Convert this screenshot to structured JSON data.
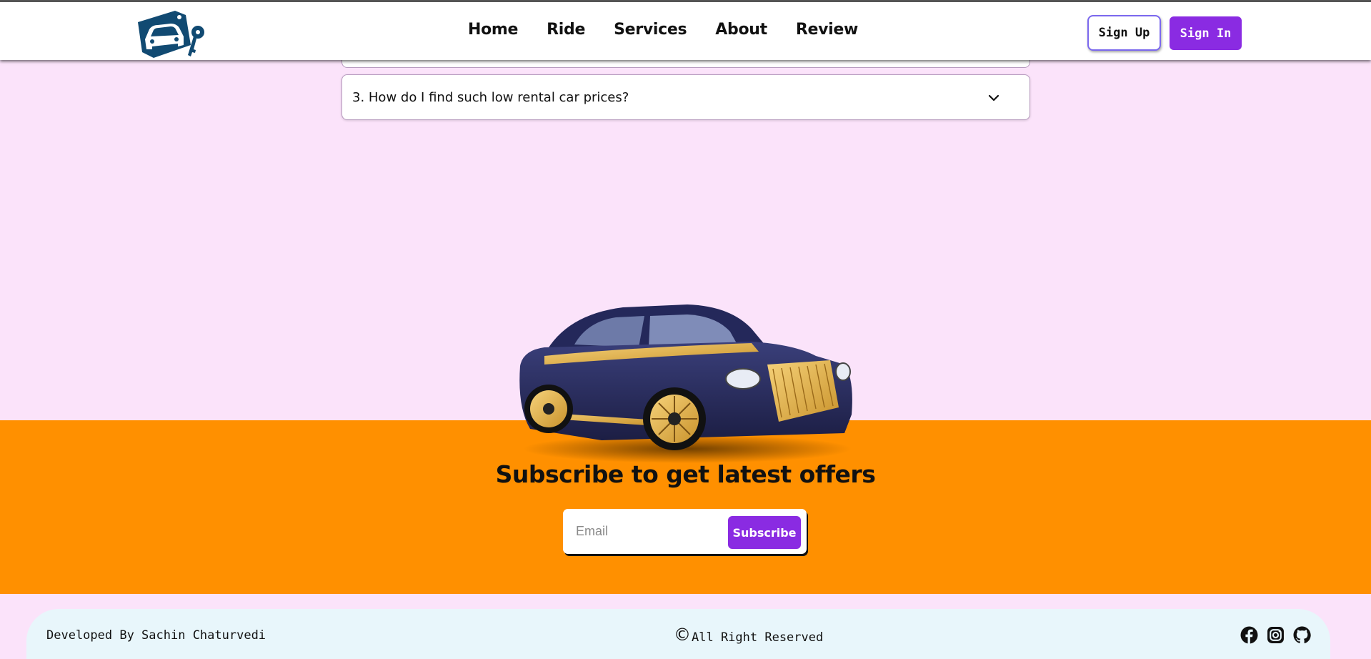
{
  "header": {
    "logo_icon": "car-key-logo-icon",
    "nav": [
      {
        "label": "Home"
      },
      {
        "label": "Ride"
      },
      {
        "label": "Services"
      },
      {
        "label": "About"
      },
      {
        "label": "Review"
      }
    ],
    "signup_label": "Sign Up",
    "signin_label": "Sign In"
  },
  "faq": {
    "items": [
      {
        "question": "3. How do I find such low rental car prices?",
        "state": "collapsed"
      }
    ],
    "chevron_icon": "chevron-down-icon"
  },
  "subscribe": {
    "title": "Subscribe to get latest offers",
    "email_placeholder": "Email",
    "button_label": "Subscribe",
    "image": "luxury-car-image"
  },
  "footer": {
    "developer": "Developed By Sachin Chaturvedi",
    "copyright_symbol": "©",
    "copyright_text": "All Right Reserved",
    "social": [
      "facebook-icon",
      "instagram-icon",
      "github-icon"
    ]
  },
  "colors": {
    "page_background": "#fbe3fa",
    "accent_purple": "#8a2be2",
    "subscribe_band": "#ff9000",
    "footer_background": "#e8f6fb"
  }
}
